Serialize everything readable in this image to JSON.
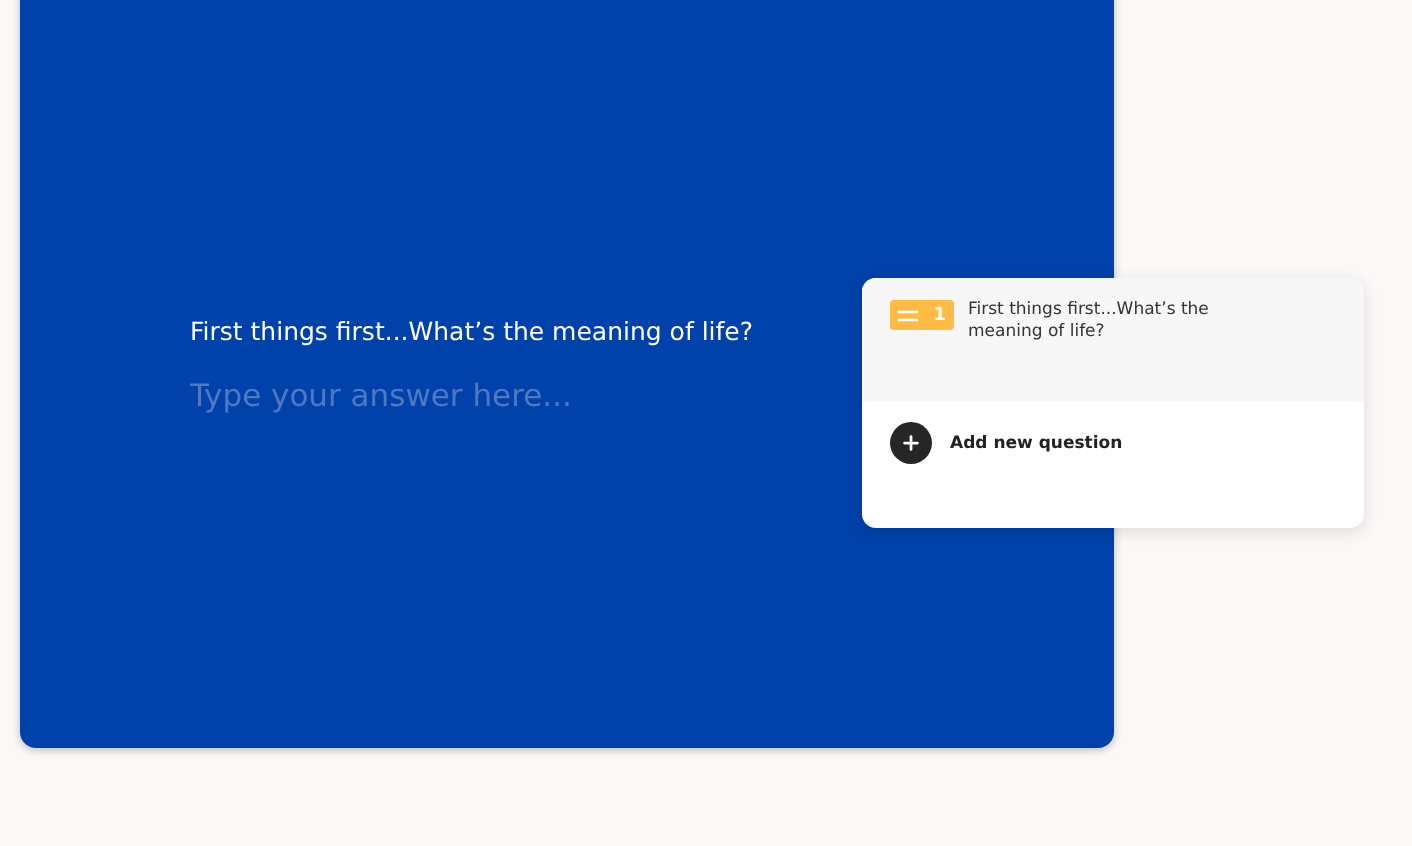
{
  "form": {
    "question": "First things first...What’s the meaning of life?",
    "answer": {
      "placeholder": "Type your answer here..."
    }
  },
  "question_list": {
    "items": [
      {
        "number": "1",
        "text": "First things first...What’s the meaning of life?"
      }
    ],
    "add_button": "Add new question"
  }
}
